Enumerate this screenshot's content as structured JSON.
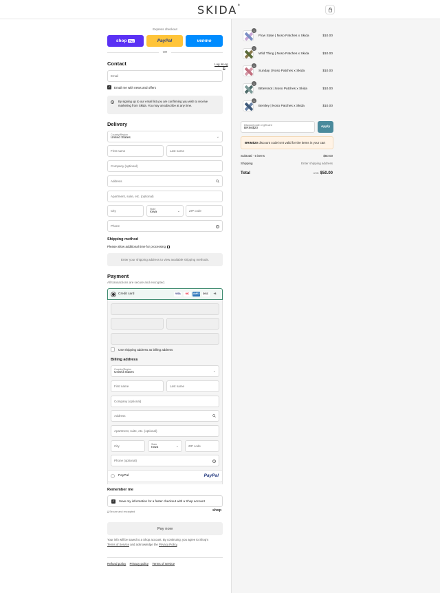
{
  "header": {
    "logo": "SKIDA",
    "logo_mark": "®",
    "cart_icon": "shopping-bag-icon"
  },
  "express": {
    "title": "Express checkout",
    "shop_pay": "shop",
    "shop_pay_badge": "Pay",
    "paypal": "PayPal",
    "venmo": "venmo",
    "or": "OR"
  },
  "contact": {
    "title": "Contact",
    "login": "Log in",
    "email_placeholder": "Email",
    "newsletter": "Email me with news and offers",
    "notice": "By signing up to our email list you are confirming you wish to receive marketing from Skida. You may unsubscribe at any time."
  },
  "delivery": {
    "title": "Delivery",
    "country_label": "Country/Region",
    "country": "United States",
    "first_name": "First name",
    "last_name": "Last name",
    "company": "Company (optional)",
    "address": "Address",
    "apartment": "Apartment, suite, etc. (optional)",
    "city": "City",
    "state_label": "State",
    "state": "Iowa",
    "zip": "ZIP code",
    "phone": "Phone"
  },
  "shipping": {
    "title": "Shipping method",
    "note": "Please allow additional time for processing",
    "placeholder": "Enter your shipping address to view available shipping methods."
  },
  "payment": {
    "title": "Payment",
    "subtitle": "All transactions are secure and encrypted.",
    "credit_card": "Credit card",
    "cards": [
      "VISA",
      "MC",
      "AMEX",
      "DISC",
      "+8"
    ],
    "use_shipping": "Use shipping address as billing address",
    "paypal": "PayPal"
  },
  "billing": {
    "title": "Billing address",
    "country_label": "Country/Region",
    "country": "United States",
    "first_name": "First name",
    "last_name": "Last name",
    "company": "Company (optional)",
    "address": "Address",
    "apartment": "Apartment, suite, etc. (optional)",
    "city": "City",
    "state_label": "State",
    "state": "Iowa",
    "zip": "ZIP code",
    "phone": "Phone (optional)"
  },
  "remember": {
    "title": "Remember me",
    "save": "Save my information for a faster checkout with a Shop account",
    "secure": "Secure and encrypted",
    "shop": "shop"
  },
  "pay": {
    "button": "Pay now",
    "legal_1": "Your info will be saved to a Shop account. By continuing, you agree to Shop's",
    "terms": "Terms of Service",
    "legal_2": "and acknowledge the",
    "privacy": "Privacy Policy",
    "legal_3": "."
  },
  "footer": {
    "links": [
      "Refund policy",
      "Privacy policy",
      "Terms of service"
    ]
  },
  "cart": {
    "items": [
      {
        "name": "Flow State | Noso Patches x Skida",
        "price": "$10.00",
        "qty": "1"
      },
      {
        "name": "Wild Thing | Noso Patches x Skida",
        "price": "$10.00",
        "qty": "1"
      },
      {
        "name": "Sunday | Noso Patches x Skida",
        "price": "$10.00",
        "qty": "1"
      },
      {
        "name": "Bittersnot | Noso Patches x Skida",
        "price": "$10.00",
        "qty": "1"
      },
      {
        "name": "Bentley | Noso Patches x Skida",
        "price": "$10.00",
        "qty": "1"
      }
    ],
    "discount_label": "Discount code or gift card",
    "discount_value": "BRIM$20",
    "apply": "Apply",
    "error_code": "BRIM$20",
    "error_text": "discount code isn't valid for the items in your cart",
    "subtotal_label": "Subtotal · 5 items",
    "subtotal": "$50.00",
    "shipping_label": "Shipping",
    "shipping_value": "Enter shipping address",
    "total_label": "Total",
    "currency": "USD",
    "total": "$50.00"
  },
  "colors": {
    "shop_pay": "#5a31f4",
    "paypal": "#ffc439",
    "venmo": "#008cff",
    "apply": "#4a8a9c",
    "error_bg": "#fff3e6"
  }
}
